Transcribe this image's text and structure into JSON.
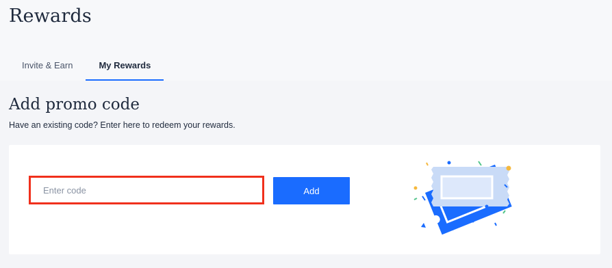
{
  "header": {
    "title": "Rewards",
    "tabs": [
      {
        "label": "Invite & Earn",
        "active": false
      },
      {
        "label": "My Rewards",
        "active": true
      }
    ]
  },
  "promo": {
    "title": "Add promo code",
    "subtitle": "Have an existing code? Enter here to redeem your rewards.",
    "input_value": "",
    "input_placeholder": "Enter code",
    "add_label": "Add",
    "illustration_icon": "ticket-coupon-icon"
  },
  "colors": {
    "accent": "#1a6cff",
    "highlight_border": "#f0301c",
    "page_bg": "#f4f5f8",
    "card_bg": "#ffffff"
  }
}
